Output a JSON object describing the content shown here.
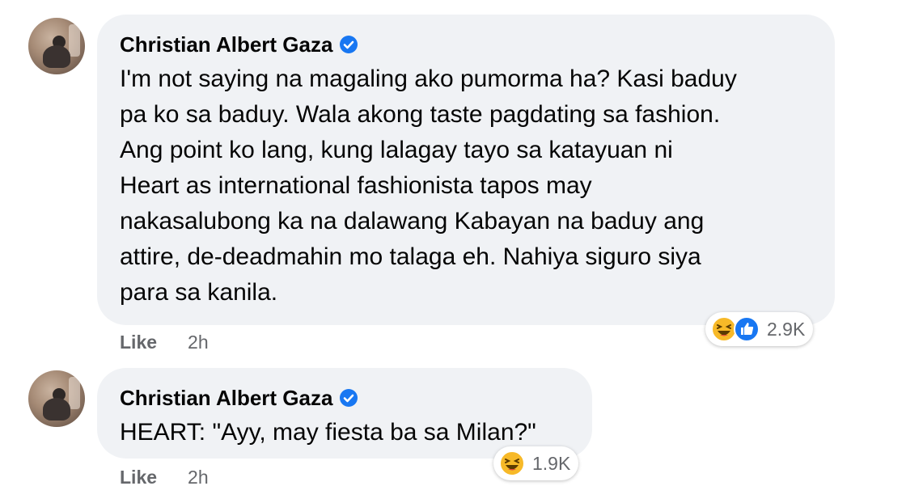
{
  "comments": [
    {
      "author": "Christian Albert Gaza",
      "text": "I'm not saying na magaling ako pumorma ha? Kasi baduy\npa ko sa baduy. Wala akong taste pagdating sa fashion.\nAng point ko lang, kung lalagay tayo sa katayuan ni\nHeart as international fashionista tapos may\nnakasalubong ka na dalawang Kabayan na baduy ang\nattire, de-deadmahin mo talaga eh. Nahiya siguro siya\npara sa kanila.",
      "like_label": "Like",
      "time": "2h",
      "reaction_count": "2.9K",
      "reactions": [
        "haha-icon",
        "like-icon"
      ]
    },
    {
      "author": "Christian Albert Gaza",
      "text": "HEART: \"Ayy, may fiesta ba sa Milan?\"",
      "like_label": "Like",
      "time": "2h",
      "reaction_count": "1.9K",
      "reactions": [
        "haha-icon"
      ]
    }
  ],
  "colors": {
    "bubble": "#f0f2f5",
    "verified": "#1877f2",
    "meta_text": "#65676b",
    "haha": "#f7b928",
    "like": "#1877f2"
  }
}
